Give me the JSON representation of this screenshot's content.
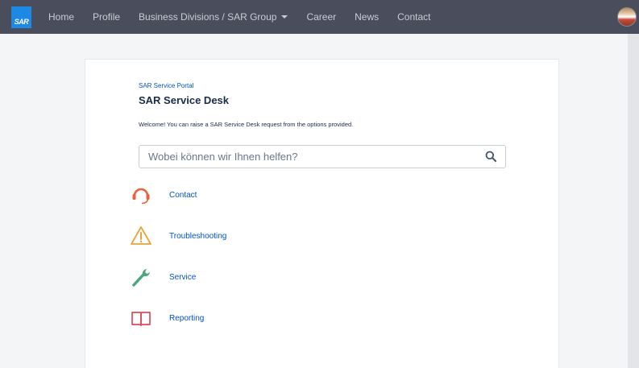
{
  "header": {
    "logo_text": "SAR",
    "nav": [
      {
        "label": "Home"
      },
      {
        "label": "Profile"
      },
      {
        "label": "Business Divisions / SAR Group",
        "has_dropdown": true
      },
      {
        "label": "Career"
      },
      {
        "label": "News"
      },
      {
        "label": "Contact"
      }
    ]
  },
  "portal": {
    "breadcrumb": "SAR Service Portal",
    "title": "SAR Service Desk",
    "welcome": "Welcome! You can raise a SAR Service Desk request from the options provided.",
    "search": {
      "placeholder": "Wobei können wir Ihnen helfen?",
      "value": ""
    },
    "options": [
      {
        "label": "Contact",
        "icon": "headset-icon",
        "color": "#e8613a"
      },
      {
        "label": "Troubleshooting",
        "icon": "warning-icon",
        "color": "#e8a33a"
      },
      {
        "label": "Service",
        "icon": "wrench-icon",
        "color": "#4aa87a"
      },
      {
        "label": "Reporting",
        "icon": "book-icon",
        "color": "#e04a5c"
      }
    ]
  },
  "colors": {
    "topbar": "#4a4e5c",
    "logo": "#1e88e5",
    "link": "#0052cc"
  }
}
